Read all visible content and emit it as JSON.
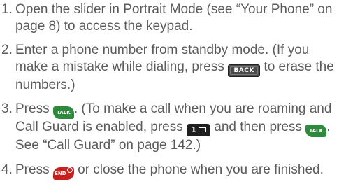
{
  "steps": [
    {
      "number": "1.",
      "text": "Open the slider in Portrait Mode (see “Your Phone” on page 8) to access the keypad."
    },
    {
      "number": "2.",
      "text_a": "Enter a phone number from standby mode. (If you make a mistake while dialing, press ",
      "text_b": " to erase the numbers.)"
    },
    {
      "number": "3.",
      "text_a": "Press ",
      "text_b": ". (To make a call when you are roaming and Call Guard is enabled, press ",
      "text_c": " and then press ",
      "text_d": ". See “Call Guard” on page 142.)"
    },
    {
      "number": "4.",
      "text_a": "Press ",
      "text_b": " or close the phone when you are finished."
    }
  ],
  "keys": {
    "back": {
      "label": "BACK",
      "icon": "back-key-icon",
      "color": "#4b4b4b"
    },
    "talk": {
      "label": "TALK",
      "icon": "talk-key-icon",
      "color": "#2e8a3c"
    },
    "one": {
      "label": "1",
      "icon": "voicemail-key-icon",
      "color": "#1f1f1f"
    },
    "end": {
      "label": "END",
      "icon": "end-key-icon",
      "color": "#c8201f"
    }
  }
}
